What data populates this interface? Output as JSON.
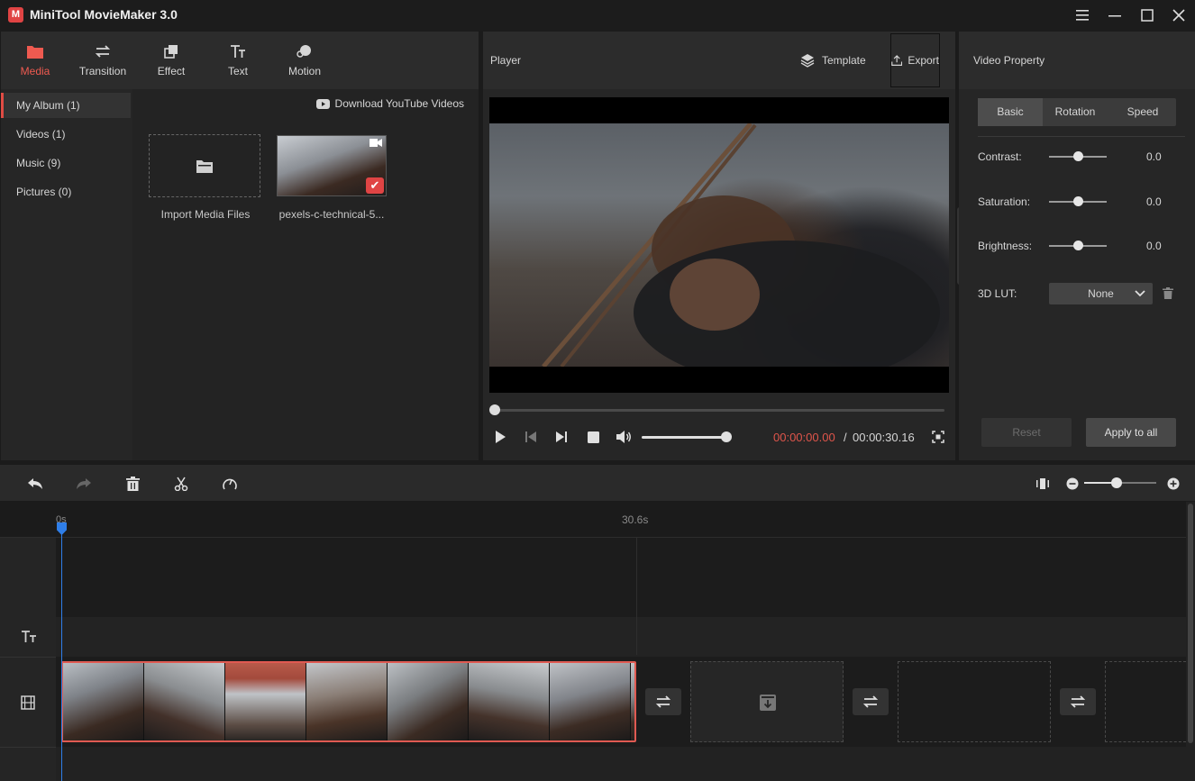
{
  "app": {
    "logo_glyph": "M",
    "title": "MiniTool MovieMaker 3.0"
  },
  "media_tabs": [
    {
      "label": "Media",
      "icon": "folder-icon",
      "active": true
    },
    {
      "label": "Transition",
      "icon": "swap-arrows-icon",
      "active": false
    },
    {
      "label": "Effect",
      "icon": "layers-icon",
      "active": false
    },
    {
      "label": "Text",
      "icon": "text-icon",
      "active": false
    },
    {
      "label": "Motion",
      "icon": "motion-icon",
      "active": false
    }
  ],
  "album": {
    "items": [
      {
        "label": "My Album (1)",
        "active": true
      },
      {
        "label": "Videos (1)",
        "active": false
      },
      {
        "label": "Music (9)",
        "active": false
      },
      {
        "label": "Pictures (0)",
        "active": false
      }
    ]
  },
  "media_area": {
    "youtube_link": "Download YouTube Videos",
    "import_label": "Import Media Files",
    "clip_label": "pexels-c-technical-5...",
    "check_glyph": "✔"
  },
  "player": {
    "title": "Player",
    "template_label": "Template",
    "export_label": "Export",
    "time_current": "00:00:00.00",
    "time_separator": "/",
    "time_total": "00:00:30.16",
    "seek_fraction": 0.0,
    "volume_fraction": 1.0
  },
  "property": {
    "title": "Video Property",
    "tabs": [
      {
        "label": "Basic",
        "active": true
      },
      {
        "label": "Rotation",
        "active": false
      },
      {
        "label": "Speed",
        "active": false
      }
    ],
    "sliders": [
      {
        "label": "Contrast:",
        "value": "0.0",
        "fraction": 0.5
      },
      {
        "label": "Saturation:",
        "value": "0.0",
        "fraction": 0.5
      },
      {
        "label": "Brightness:",
        "value": "0.0",
        "fraction": 0.5
      }
    ],
    "lut_label": "3D LUT:",
    "lut_value": "None",
    "reset_label": "Reset",
    "apply_label": "Apply to all"
  },
  "timeline": {
    "ruler_start": "0s",
    "ruler_end": "30.6s",
    "zoom_fraction": 0.45
  },
  "colors": {
    "accent": "#e04c44",
    "playhead": "#2f7ee8"
  }
}
